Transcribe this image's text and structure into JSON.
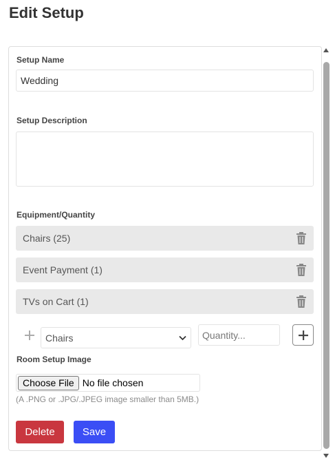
{
  "page": {
    "title": "Edit Setup"
  },
  "form": {
    "name_label": "Setup Name",
    "name_value": "Wedding",
    "description_label": "Setup Description",
    "description_value": "",
    "equipment_label": "Equipment/Quantity",
    "equipment_items": [
      {
        "label": "Chairs (25)",
        "icon": "trash-icon"
      },
      {
        "label": "Event Payment (1)",
        "icon": "trash-icon"
      },
      {
        "label": "TVs on Cart (1)",
        "icon": "trash-icon"
      }
    ],
    "equipment_select_value": "Chairs",
    "quantity_placeholder": "Quantity...",
    "image_label": "Room Setup Image",
    "file_button_label": "Choose File",
    "file_status": "No file chosen",
    "file_hint": "(A .PNG or .JPG/.JPEG image smaller than 5MB.)",
    "delete_label": "Delete",
    "save_label": "Save"
  },
  "colors": {
    "delete": "#c9373f",
    "save": "#3b4ef5",
    "item_background": "#e9e9e9"
  }
}
